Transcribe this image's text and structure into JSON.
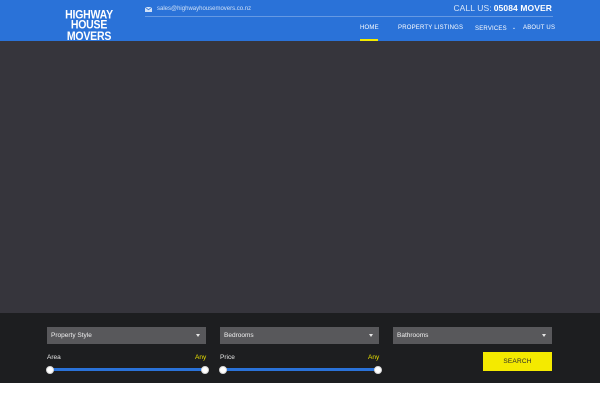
{
  "brand": {
    "logo_line1": "HIGHWAY",
    "logo_line2": "HOUSE MOVERS"
  },
  "contact": {
    "email": "sales@highwayhousemovers.co.nz",
    "call_label": "CALL US:",
    "phone": "05084 MOVER"
  },
  "nav": {
    "items": [
      {
        "label": "HOME",
        "active": true
      },
      {
        "label": "PROPERTY LISTINGS"
      },
      {
        "label": "SERVICES",
        "has_dropdown": true
      },
      {
        "label": "ABOUT US"
      }
    ]
  },
  "search": {
    "property_style": "Property Style",
    "bedrooms": "Bedrooms",
    "bathrooms": "Bathrooms",
    "area_label": "Area",
    "area_value": "Any",
    "price_label": "Price",
    "price_value": "Any",
    "button": "SEARCH"
  },
  "colors": {
    "header_blue": "#2a72d8",
    "hero_bg": "#36353c",
    "panel_bg": "#1d1e20",
    "accent_yellow": "#f4ea00"
  },
  "icons": {
    "email": "envelope-icon",
    "dropdown": "caret-down-icon"
  }
}
